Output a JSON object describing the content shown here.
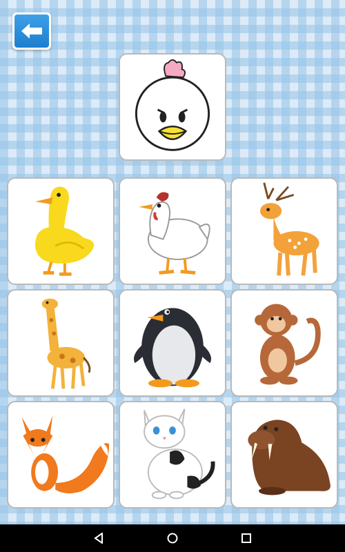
{
  "screen": {
    "back_button_icon": "arrow-left-icon",
    "target_animal": "chicken",
    "choices": [
      "duck",
      "hen",
      "deer",
      "giraffe",
      "penguin",
      "monkey",
      "fox",
      "cat",
      "walrus"
    ]
  },
  "navbar": {
    "back_icon": "triangle-back-icon",
    "home_icon": "circle-home-icon",
    "recents_icon": "square-recents-icon"
  },
  "colors": {
    "accent": "#1c7fcf",
    "card_border": "#b9b9b9",
    "background": "#dcebf7",
    "navbar": "#000000"
  }
}
